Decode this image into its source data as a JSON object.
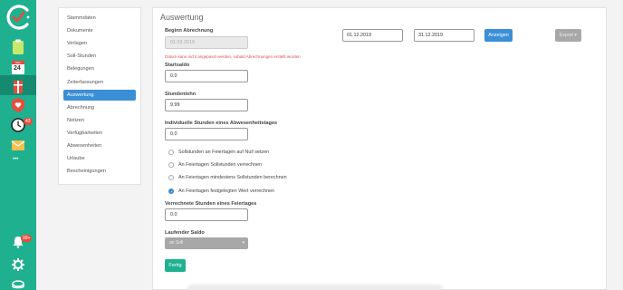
{
  "sidebar": {
    "calendar_day": "24",
    "calendar_month": "Mon",
    "clock_badge": "43",
    "bell_badge": "99+",
    "more": "•••"
  },
  "nav": {
    "items": [
      {
        "label": "Stammdaten"
      },
      {
        "label": "Dokumente"
      },
      {
        "label": "Verlagen"
      },
      {
        "label": "Soll-Stunden"
      },
      {
        "label": "Belegungen"
      },
      {
        "label": "Zeiterfassungen"
      },
      {
        "label": "Auswertung"
      },
      {
        "label": "Abrechnung"
      },
      {
        "label": "Notizen"
      },
      {
        "label": "Verfügbarkeiten"
      },
      {
        "label": "Abwesenheiten"
      },
      {
        "label": "Urlaube"
      },
      {
        "label": "Bescheinigungen"
      }
    ],
    "active_index": 6
  },
  "main": {
    "title": "Auswertung",
    "begin_label": "Beginn Abrechnung",
    "begin_value": "01.03.2019",
    "error_text": "Datum kann nicht angepasst werden, sobald Abrechnungen erstellt wurden",
    "startsaldo_label": "Startsaldo",
    "startsaldo_value": "0.0",
    "stundenlohn_label": "Stundenlohn",
    "stundenlohn_value": "9.99",
    "abwesenheit_label": "Individuelle Stunden eines Abwesenheitstages",
    "abwesenheit_value": "0.0",
    "radio_options": [
      {
        "label": "Sollstunden an Feiertagen auf Null setzen",
        "checked": false
      },
      {
        "label": "An Feiertagen Sollstunden verrechnen",
        "checked": false
      },
      {
        "label": "An Feiertagen mindestens Sollstunden berechnen",
        "checked": false
      },
      {
        "label": "An Feiertagen festgelegten Wert verrechnen",
        "checked": true
      }
    ],
    "feiertag_label": "Verrechnete Stunden eines Feiertages",
    "feiertag_value": "0.0",
    "saldo_label": "Laufender Saldo",
    "saldo_select": "an Soll",
    "fertig_label": "Fertig",
    "date_from": "01.12.2019",
    "date_to": "31.12.2019",
    "show_label": "Anzeigen",
    "export_label": "Export ▾"
  },
  "colors": {
    "brand": "#1fb08f",
    "accent": "#3a8fd6",
    "error": "#d9534f"
  }
}
